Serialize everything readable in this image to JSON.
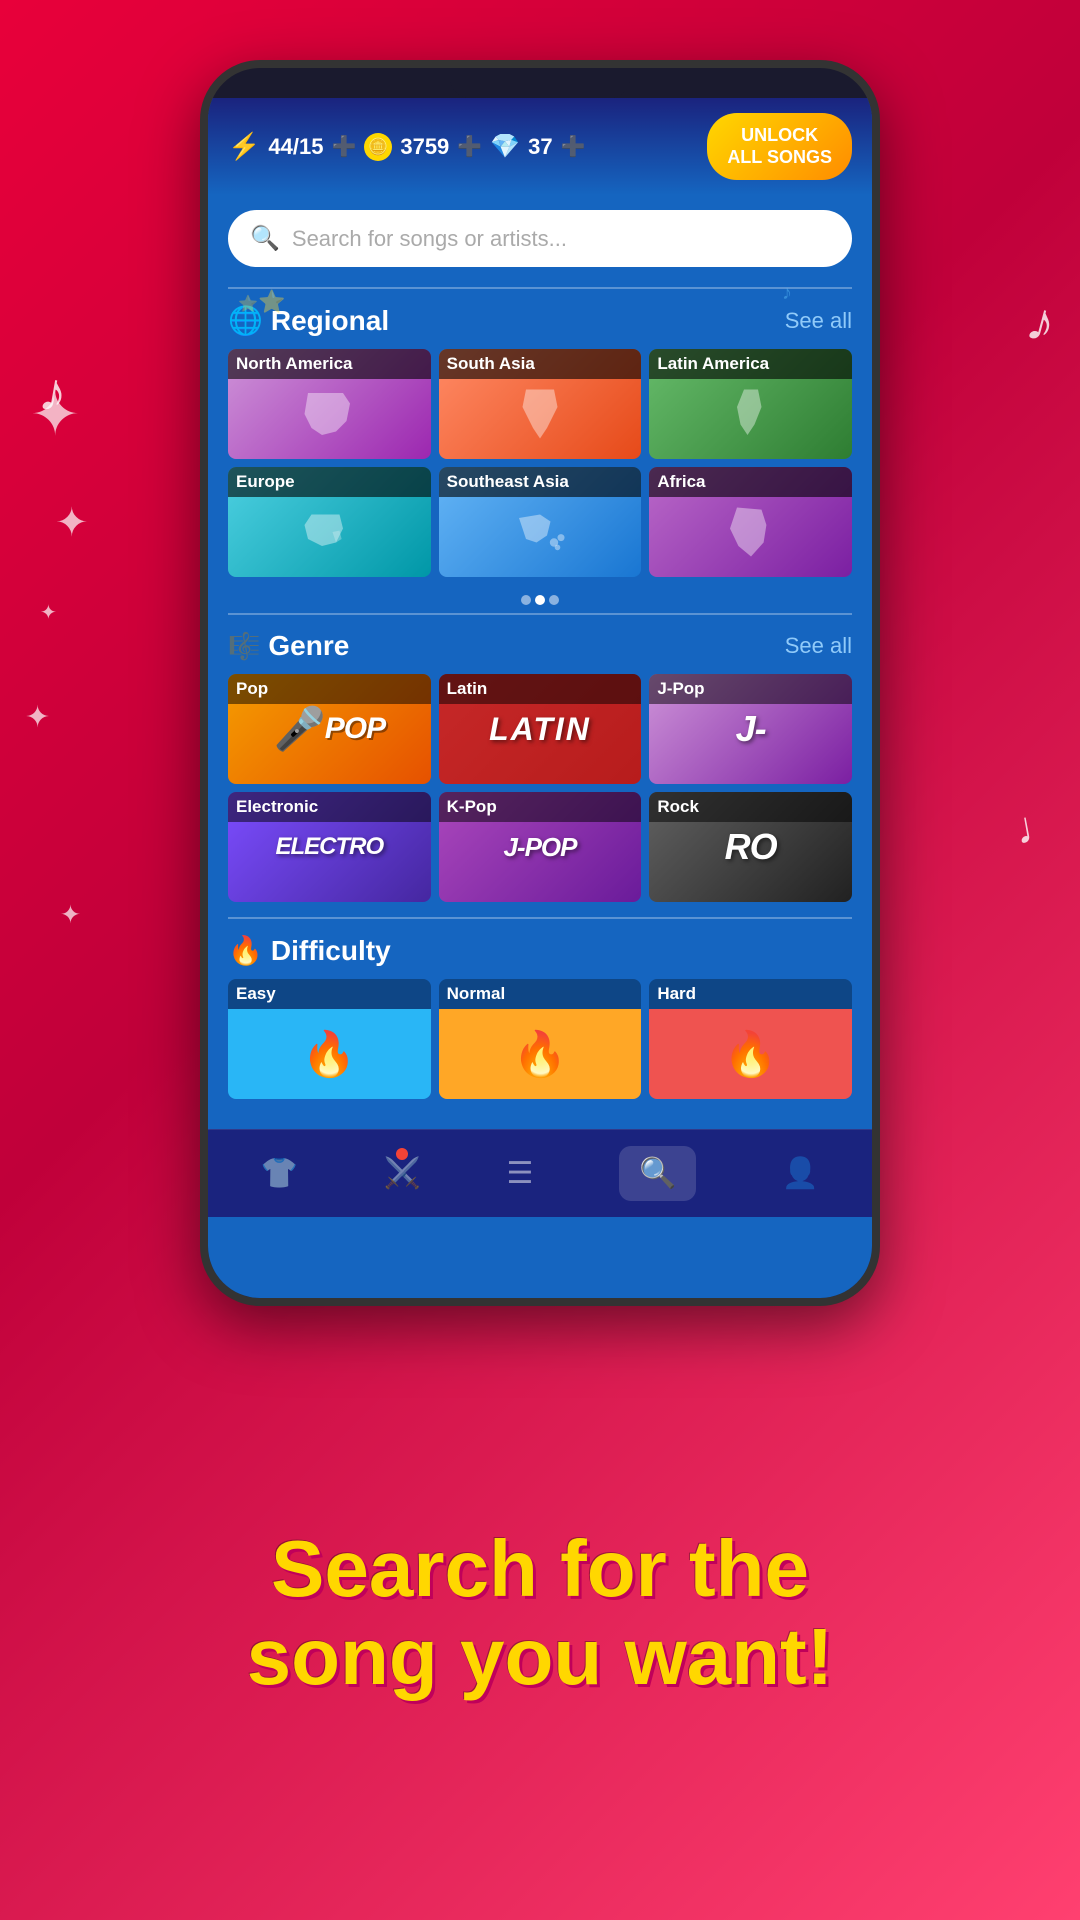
{
  "background": {
    "gradient_start": "#e8003a",
    "gradient_end": "#ff4070"
  },
  "header": {
    "energy": "44/15",
    "coins": "3759",
    "gems": "37",
    "unlock_button": "UNLOCK\nALL SONGS"
  },
  "search": {
    "placeholder": "Search for songs or artists..."
  },
  "regional_section": {
    "title": "Regional",
    "see_all": "See all",
    "cards": [
      {
        "label": "North America",
        "bg_class": "bg-north-america"
      },
      {
        "label": "South Asia",
        "bg_class": "bg-south-asia"
      },
      {
        "label": "Latin America",
        "bg_class": "bg-latin-america"
      },
      {
        "label": "Europe",
        "bg_class": "bg-europe"
      },
      {
        "label": "Southeast Asia",
        "bg_class": "bg-southeast-asia"
      },
      {
        "label": "Africa",
        "bg_class": "bg-africa"
      }
    ]
  },
  "genre_section": {
    "title": "Genre",
    "see_all": "See all",
    "cards": [
      {
        "label": "Pop",
        "display": "🎤POP",
        "bg_class": "bg-pop"
      },
      {
        "label": "Latin",
        "display": "LATIN",
        "bg_class": "bg-latin"
      },
      {
        "label": "J-Pop",
        "display": "J-",
        "bg_class": "bg-jpop"
      },
      {
        "label": "Electronic",
        "display": "ELECTRO",
        "bg_class": "bg-electronic"
      },
      {
        "label": "K-Pop",
        "display": "J-POP",
        "bg_class": "bg-kpop"
      },
      {
        "label": "Rock",
        "display": "RO",
        "bg_class": "bg-rock"
      }
    ]
  },
  "difficulty_section": {
    "title": "Difficulty",
    "cards": [
      {
        "label": "Easy",
        "bg_class": "bg-easy",
        "icon": "🔥"
      },
      {
        "label": "Normal",
        "bg_class": "bg-normal",
        "icon": "🔥"
      },
      {
        "label": "Hard",
        "bg_class": "bg-hard",
        "icon": "🔥"
      }
    ]
  },
  "bottom_nav": {
    "items": [
      {
        "icon": "👕",
        "label": "shop",
        "active": false
      },
      {
        "icon": "⚔️",
        "label": "battle",
        "active": false
      },
      {
        "icon": "☰",
        "label": "songs",
        "active": false
      },
      {
        "icon": "🔍",
        "label": "search",
        "active": true
      },
      {
        "icon": "👤",
        "label": "profile",
        "active": false
      }
    ]
  },
  "banner": {
    "line1": "Search for the",
    "line2": "song you want!"
  }
}
